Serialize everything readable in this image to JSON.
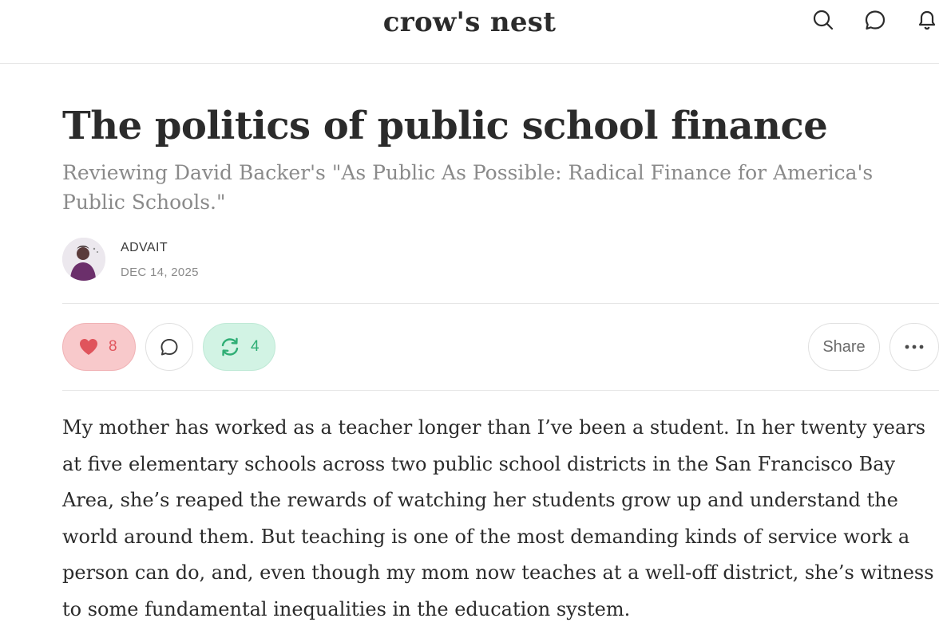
{
  "site": {
    "title": "crow's nest"
  },
  "header_icons": [
    "search-icon",
    "chat-bubble-icon",
    "bell-icon"
  ],
  "article": {
    "title": "The politics of public school finance",
    "subtitle": "Reviewing David Backer's \"As Public As Possible: Radical Finance for America's Public Schools.\"",
    "author": "ADVAIT",
    "date": "DEC 14, 2025",
    "body": "My mother has worked as a teacher longer than I’ve been a student. In her twenty years at five elementary schools across two public school districts in the San Francisco Bay Area, she’s reaped the rewards of watching her students grow up and understand the world around them. But teaching is one of the most demanding kinds of service work a person can do, and, even though my mom now teaches at a well-off district, she’s witness to some fundamental inequalities in the education system."
  },
  "actions": {
    "likes": "8",
    "restacks": "4",
    "share_label": "Share"
  },
  "colors": {
    "like_bg": "#f8c9cb",
    "like_accent": "#e0545c",
    "restack_bg": "#d2f3e4",
    "restack_accent": "#2fae75",
    "subtitle": "#8a8a8a"
  }
}
